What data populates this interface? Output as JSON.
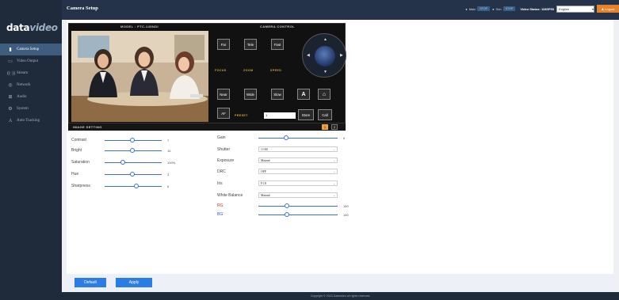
{
  "app": {
    "logo_main": "data",
    "logo_accent": "video",
    "page_title": "Camera Setup"
  },
  "sidebar": {
    "items": [
      {
        "label": "Camera Setup",
        "icon": "camera-icon"
      },
      {
        "label": "Video Output",
        "icon": "monitor-icon"
      },
      {
        "label": "Stream",
        "icon": "stream-icon"
      },
      {
        "label": "Network",
        "icon": "globe-icon"
      },
      {
        "label": "Audio",
        "icon": "audio-icon"
      },
      {
        "label": "System",
        "icon": "gear-icon"
      },
      {
        "label": "Auto Tracking",
        "icon": "tracking-icon"
      }
    ]
  },
  "topbar": {
    "main_label": "Main",
    "main_status": "STOP",
    "sub_label": "Sub",
    "sub_status": "STOP",
    "video_status": "Video Status: 1080P50",
    "language": "English",
    "logout": "Logout"
  },
  "camera_panel": {
    "model_label": "MODEL : PTC-145NDI",
    "control_label": "CAMERA CONTROL",
    "focus_label": "FOCUS",
    "zoom_label": "ZOOM",
    "speed_label": "SPEED",
    "preset_label": "PRESET",
    "buttons": {
      "far": "Far",
      "near": "Near",
      "af": "AF",
      "tele": "Tele",
      "wide": "Wide",
      "fast": "Fast",
      "slow": "Slow",
      "store": "Store",
      "call": "Call"
    },
    "preset_value": "1"
  },
  "image_setting": {
    "title": "IMAGE SETTING",
    "tabs": [
      "1",
      "2"
    ],
    "sliders_left": [
      {
        "label": "Contrast",
        "value": "7",
        "fraction": 0.48
      },
      {
        "label": "Bright",
        "value": "16",
        "fraction": 0.48
      },
      {
        "label": "Saturation",
        "value": "100%",
        "fraction": 0.32
      },
      {
        "label": "Hue",
        "value": "3",
        "fraction": 0.48
      },
      {
        "label": "Sharpness",
        "value": "6",
        "fraction": 0.56
      }
    ],
    "gain": {
      "label": "Gain",
      "value": "6",
      "fraction": 0.35
    },
    "selects": [
      {
        "label": "Shutter",
        "value": "1/100"
      },
      {
        "label": "Exposure",
        "value": "Manual"
      },
      {
        "label": "DRC",
        "value": "OFF"
      },
      {
        "label": "Iris",
        "value": "F1.8"
      },
      {
        "label": "White Balance",
        "value": "Manual"
      }
    ],
    "rg": {
      "label": "RG",
      "value": "160",
      "fraction": 0.36,
      "color": "#d12b2b"
    },
    "bg": {
      "label": "BG",
      "value": "160",
      "fraction": 0.36,
      "color": "#3a4fd1"
    }
  },
  "actions": {
    "default": "Default",
    "apply": "Apply"
  },
  "footer": {
    "copyright": "Copyright © 2023 Datavideo all rights reserved."
  },
  "colors": {
    "sidebar": "#1f2b3b",
    "accent": "#2a7de3",
    "preset_active": "#e8a339",
    "logout": "#e8822a"
  }
}
